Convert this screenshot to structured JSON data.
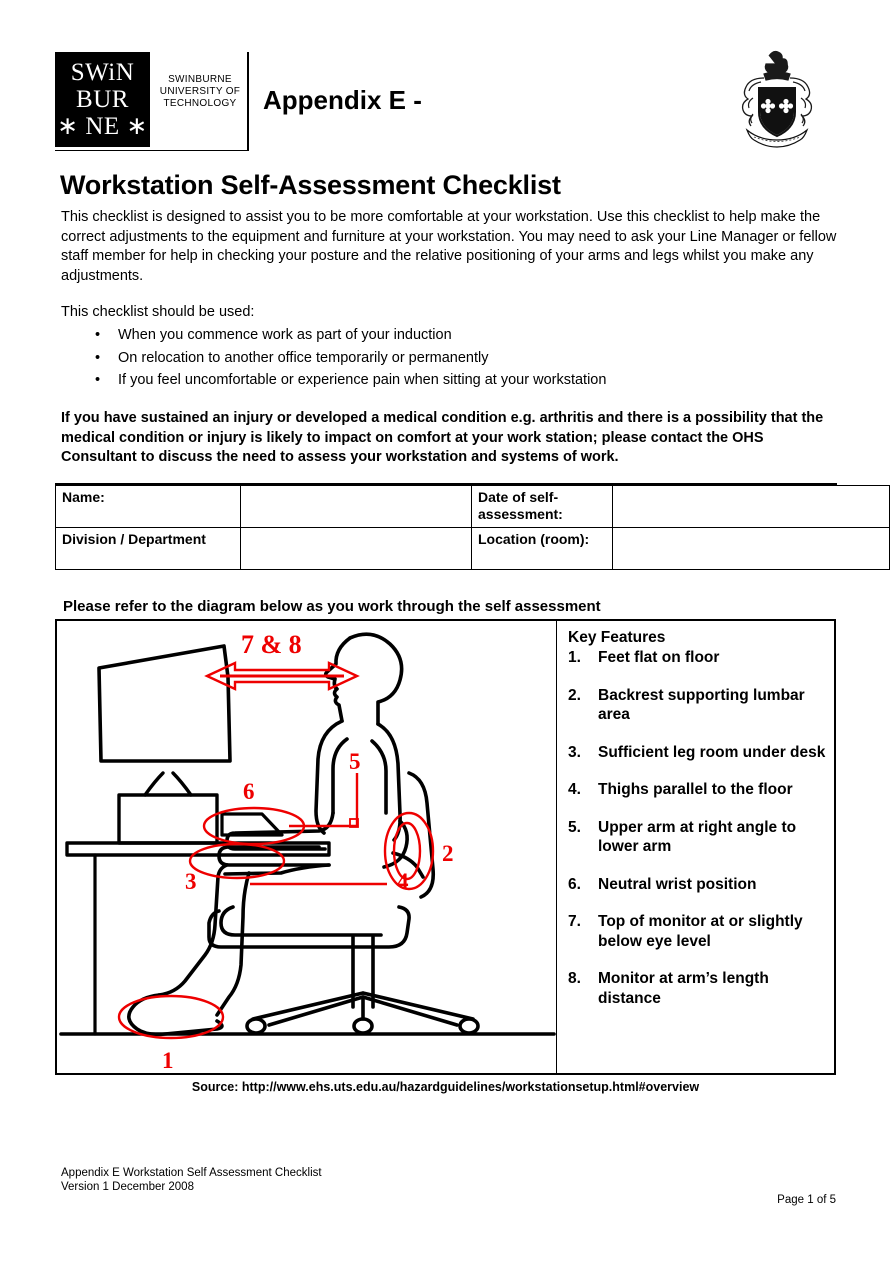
{
  "header": {
    "logo_lines": [
      "SWiN",
      "BUR",
      "∗ NE ∗"
    ],
    "logo_wordmark": "SWINBURNE UNIVERSITY OF TECHNOLOGY",
    "logo_word_1": "SWINBURNE",
    "logo_word_2": "UNIVERSITY OF",
    "logo_word_3": "TECHNOLOGY",
    "appendix_title": "Appendix E -",
    "crest_name": "university-crest"
  },
  "document": {
    "title": "Workstation Self-Assessment Checklist",
    "intro": "This checklist is designed to assist you to be more comfortable at your workstation. Use this checklist to help make the correct adjustments to the equipment and furniture at your workstation. You may need to ask your Line Manager or fellow staff member for help in checking your posture and the relative positioning of your arms and legs whilst you make any adjustments.",
    "used_lead": "This checklist should be used:",
    "bullets": [
      "When you commence work as part of your induction",
      "On relocation to another office temporarily or permanently",
      "If you feel uncomfortable or experience pain when sitting at your workstation"
    ],
    "bullet_glyph": "•",
    "warning": "If you have sustained an injury or developed a medical condition e.g. arthritis and there is a possibility that the medical condition or injury is likely to impact on comfort at your work station; please contact the OHS Consultant to discuss the need to assess your workstation and systems of work."
  },
  "details_table": {
    "rows": [
      {
        "label_1": "Name:",
        "value_1": "",
        "label_2": "Date of self-assessment:",
        "value_2": ""
      },
      {
        "label_1": "Division / Department",
        "value_1": "",
        "label_2": "Location (room):",
        "value_2": ""
      }
    ]
  },
  "diagram": {
    "heading": "Please refer to the diagram below as you work through the self assessment",
    "source": "Source: http://www.ehs.uts.edu.au/hazardguidelines/workstationsetup.html#overview",
    "annotation_color": "#ee0000",
    "line_color": "#000000",
    "callouts": {
      "c1": "1",
      "c2": "2",
      "c3": "3",
      "c4": "4",
      "c5": "5",
      "c6": "6",
      "c78": "7 & 8"
    }
  },
  "key_features": {
    "title": "Key Features",
    "items": [
      {
        "num": "1.",
        "text": "Feet flat on floor"
      },
      {
        "num": "2.",
        "text": "Backrest supporting lumbar area"
      },
      {
        "num": "3.",
        "text": "Sufficient leg room under desk"
      },
      {
        "num": "4.",
        "text": "Thighs parallel to the floor"
      },
      {
        "num": "5.",
        "text": "Upper arm at right angle to lower arm"
      },
      {
        "num": "6.",
        "text": "Neutral wrist position"
      },
      {
        "num": "7.",
        "text": "Top of monitor at or slightly below eye level"
      },
      {
        "num": "8.",
        "text": "Monitor at arm’s length distance"
      }
    ]
  },
  "footer": {
    "line_1": "Appendix E Workstation Self Assessment Checklist",
    "line_2": "Version 1 December 2008",
    "page_label": "Page 1 of 5"
  }
}
